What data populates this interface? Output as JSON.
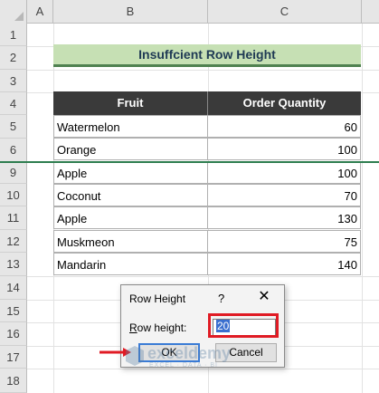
{
  "columns": {
    "a": "A",
    "b": "B",
    "c": "C"
  },
  "rows": [
    "1",
    "2",
    "3",
    "4",
    "5",
    "6",
    "9",
    "10",
    "11",
    "12",
    "13",
    "14",
    "15",
    "16",
    "17",
    "18"
  ],
  "title": "Insuffcient Row Height",
  "table": {
    "headers": {
      "fruit": "Fruit",
      "qty": "Order Quantity"
    },
    "rows": [
      {
        "fruit": "Watermelon",
        "qty": "60"
      },
      {
        "fruit": "Orange",
        "qty": "100"
      },
      {
        "fruit": "Apple",
        "qty": "100"
      },
      {
        "fruit": "Coconut",
        "qty": "70"
      },
      {
        "fruit": "Apple",
        "qty": "130"
      },
      {
        "fruit": "Muskmeon",
        "qty": "75"
      },
      {
        "fruit": "Mandarin",
        "qty": "140"
      }
    ]
  },
  "dialog": {
    "title": "Row Height",
    "help": "?",
    "close": "✕",
    "label_accel": "R",
    "label_rest": "ow height:",
    "value": "20",
    "ok": "OK",
    "cancel": "Cancel"
  },
  "watermark": {
    "name": "exceldemy",
    "tagline": "EXCEL · DATA · BI"
  },
  "colors": {
    "title_bg": "#c6e0b4",
    "header_bg": "#3a3a3a",
    "highlight": "#e01b24",
    "hidden_row_line": "#2e7d4f"
  }
}
